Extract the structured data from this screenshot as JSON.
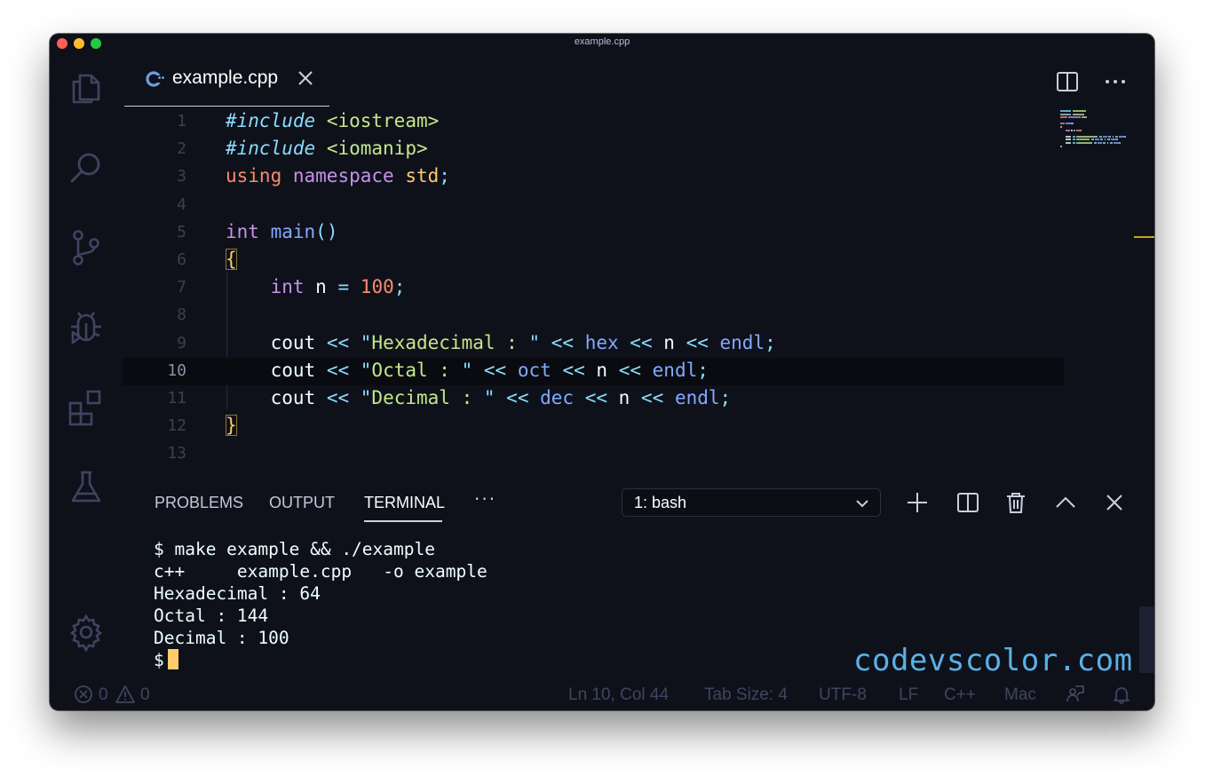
{
  "window": {
    "title": "example.cpp"
  },
  "activity_bar": [
    "files-icon",
    "search-icon",
    "source-control-icon",
    "debug-icon",
    "extensions-icon",
    "testing-icon",
    "gear-icon"
  ],
  "editor_tab": {
    "label": "example.cpp",
    "icon": "cpp-file-icon"
  },
  "editor_actions": [
    "split-editor-icon",
    "more-actions-icon"
  ],
  "code": {
    "line_numbers": [
      "1",
      "2",
      "3",
      "4",
      "5",
      "6",
      "7",
      "8",
      "9",
      "10",
      "11",
      "12",
      "13"
    ],
    "lines": [
      [
        {
          "t": "#include",
          "c": "k-inc"
        },
        {
          "t": " "
        },
        {
          "t": "<iostream>",
          "c": "k-hdr"
        }
      ],
      [
        {
          "t": "#include",
          "c": "k-inc"
        },
        {
          "t": " "
        },
        {
          "t": "<iomanip>",
          "c": "k-hdr"
        }
      ],
      [
        {
          "t": "using",
          "c": "k-using"
        },
        {
          "t": " "
        },
        {
          "t": "namespace",
          "c": "k-ns"
        },
        {
          "t": " "
        },
        {
          "t": "std",
          "c": "k-std"
        },
        {
          "t": ";",
          "c": "k-pun"
        }
      ],
      [],
      [
        {
          "t": "int",
          "c": "k-type"
        },
        {
          "t": " "
        },
        {
          "t": "main",
          "c": "k-fn"
        },
        {
          "t": "()",
          "c": "k-pun"
        }
      ],
      [
        {
          "t": "{",
          "c": "bm"
        }
      ],
      [
        {
          "t": "    "
        },
        {
          "t": "int",
          "c": "k-type"
        },
        {
          "t": " "
        },
        {
          "t": "n",
          "c": "k-var"
        },
        {
          "t": " "
        },
        {
          "t": "=",
          "c": "k-pun"
        },
        {
          "t": " "
        },
        {
          "t": "100",
          "c": "k-num"
        },
        {
          "t": ";",
          "c": "k-pun"
        }
      ],
      [],
      [
        {
          "t": "    "
        },
        {
          "t": "cout",
          "c": "k-var"
        },
        {
          "t": " "
        },
        {
          "t": "<<",
          "c": "k-pun"
        },
        {
          "t": " "
        },
        {
          "t": "\"",
          "c": "k-pun"
        },
        {
          "t": "Hexadecimal : ",
          "c": "k-str"
        },
        {
          "t": "\"",
          "c": "k-pun"
        },
        {
          "t": " "
        },
        {
          "t": "<<",
          "c": "k-pun"
        },
        {
          "t": " "
        },
        {
          "t": "hex",
          "c": "k-fn"
        },
        {
          "t": " "
        },
        {
          "t": "<<",
          "c": "k-pun"
        },
        {
          "t": " "
        },
        {
          "t": "n",
          "c": "k-var"
        },
        {
          "t": " "
        },
        {
          "t": "<<",
          "c": "k-pun"
        },
        {
          "t": " "
        },
        {
          "t": "endl",
          "c": "k-fn"
        },
        {
          "t": ";",
          "c": "k-pun"
        }
      ],
      [
        {
          "t": "    "
        },
        {
          "t": "cout",
          "c": "k-var"
        },
        {
          "t": " "
        },
        {
          "t": "<<",
          "c": "k-pun"
        },
        {
          "t": " "
        },
        {
          "t": "\"",
          "c": "k-pun"
        },
        {
          "t": "Octal : ",
          "c": "k-str"
        },
        {
          "t": "\"",
          "c": "k-pun"
        },
        {
          "t": " "
        },
        {
          "t": "<<",
          "c": "k-pun"
        },
        {
          "t": " "
        },
        {
          "t": "oct",
          "c": "k-fn"
        },
        {
          "t": " "
        },
        {
          "t": "<<",
          "c": "k-pun"
        },
        {
          "t": " "
        },
        {
          "t": "n",
          "c": "k-var"
        },
        {
          "t": " "
        },
        {
          "t": "<<",
          "c": "k-pun"
        },
        {
          "t": " "
        },
        {
          "t": "endl",
          "c": "k-fn"
        },
        {
          "t": ";",
          "c": "k-pun"
        }
      ],
      [
        {
          "t": "    "
        },
        {
          "t": "cout",
          "c": "k-var"
        },
        {
          "t": " "
        },
        {
          "t": "<<",
          "c": "k-pun"
        },
        {
          "t": " "
        },
        {
          "t": "\"",
          "c": "k-pun"
        },
        {
          "t": "Decimal : ",
          "c": "k-str"
        },
        {
          "t": "\"",
          "c": "k-pun"
        },
        {
          "t": " "
        },
        {
          "t": "<<",
          "c": "k-pun"
        },
        {
          "t": " "
        },
        {
          "t": "dec",
          "c": "k-fn"
        },
        {
          "t": " "
        },
        {
          "t": "<<",
          "c": "k-pun"
        },
        {
          "t": " "
        },
        {
          "t": "n",
          "c": "k-var"
        },
        {
          "t": " "
        },
        {
          "t": "<<",
          "c": "k-pun"
        },
        {
          "t": " "
        },
        {
          "t": "endl",
          "c": "k-fn"
        },
        {
          "t": ";",
          "c": "k-pun"
        }
      ],
      [
        {
          "t": "}",
          "c": "bm"
        }
      ],
      []
    ],
    "current_line": 10
  },
  "panel": {
    "tabs": [
      "PROBLEMS",
      "OUTPUT",
      "TERMINAL"
    ],
    "active_tab": "TERMINAL",
    "more": "···",
    "terminal_select": "1: bash",
    "actions": [
      "add-terminal-icon",
      "split-terminal-icon",
      "trash-icon",
      "maximize-panel-icon",
      "close-panel-icon"
    ]
  },
  "terminal": {
    "lines": [
      "$ make example && ./example",
      "c++     example.cpp   -o example",
      "Hexadecimal : 64",
      "Octal : 144",
      "Decimal : 100"
    ],
    "prompt": "$"
  },
  "watermark": "codevscolor.com",
  "status_bar": {
    "errors": "0",
    "warnings": "0",
    "position": "Ln 10, Col 44",
    "tab_size": "Tab Size: 4",
    "encoding": "UTF-8",
    "eol": "LF",
    "language": "C++",
    "os": "Mac"
  },
  "colors": {
    "background": "#0f111a",
    "cursor": "#ffcb6b",
    "watermark": "#5ab1e6",
    "keyword": "#c792ea",
    "string": "#c3e88d",
    "function": "#82aaff"
  }
}
